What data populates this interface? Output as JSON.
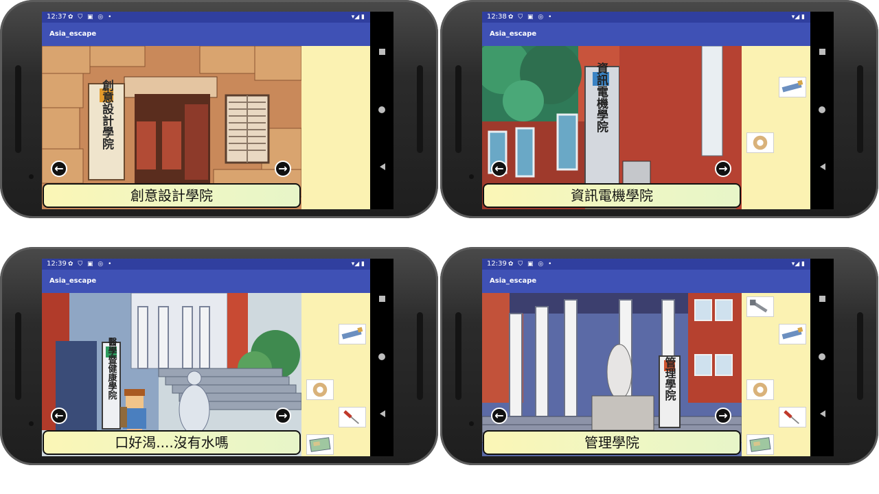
{
  "phones": [
    {
      "status_time": "12:37",
      "app_title": "Asia_escape",
      "scene": "creative-design-college",
      "sign_text": "創意設計學院",
      "dialog_text": "創意設計學院",
      "inventory": []
    },
    {
      "status_time": "12:38",
      "app_title": "Asia_escape",
      "scene": "eecs-college",
      "sign_text": "資訊電機學院",
      "dialog_text": "資訊電機學院",
      "inventory": [
        "glue-stick-icon",
        "tape-roll-icon"
      ]
    },
    {
      "status_time": "12:39",
      "app_title": "Asia_escape",
      "scene": "medical-health-college",
      "sign_text": "醫學暨健康學院",
      "dialog_text": "口好渴....沒有水嗎",
      "inventory": [
        "glue-stick-icon",
        "tape-roll-icon",
        "screwdriver-icon",
        "map-icon"
      ]
    },
    {
      "status_time": "12:39",
      "app_title": "Asia_escape",
      "scene": "management-college",
      "sign_text": "管理學院",
      "dialog_text": "管理學院",
      "inventory": [
        "bolt-icon",
        "glue-stick-icon",
        "tape-roll-icon",
        "screwdriver-icon",
        "map-icon"
      ]
    }
  ],
  "colors": {
    "status_bar": "#303f9f",
    "app_bar": "#3f51b5",
    "inventory_bg": "#fbf2b2",
    "dialog_bg": "#fbf6b6"
  }
}
